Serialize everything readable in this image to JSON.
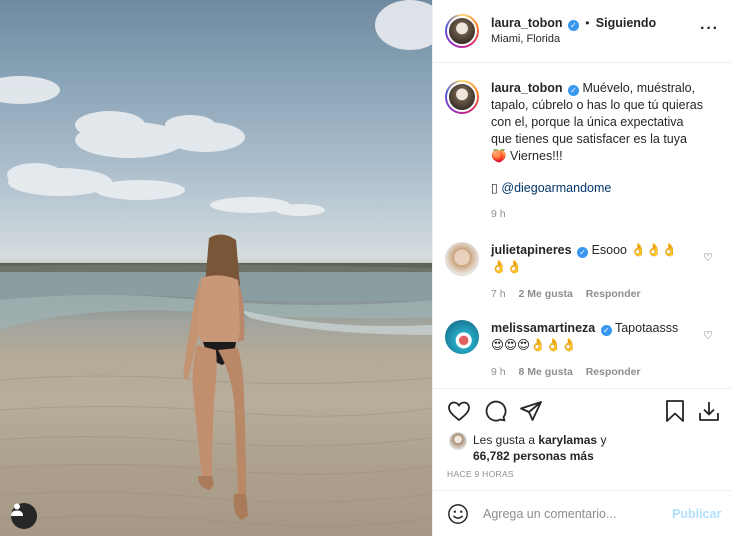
{
  "post": {
    "username": "laura_tobon",
    "follow_separator": "•",
    "follow_status": "Siguiendo",
    "location": "Miami, Florida",
    "more_icon": "more-horizontal-icon",
    "verified_icon": "verified-badge-icon"
  },
  "caption": {
    "username": "laura_tobon",
    "text": "Muévelo, muéstralo, tapalo, cúbrelo o has lo que tú quieras con el, porque la única expectativa que tienes que satisfacer es la tuya 🍑 Viernes!!!",
    "photo_credit_glyph": "▯",
    "photo_credit": "@diegoarmandome",
    "time": "9 h"
  },
  "comments": [
    {
      "username": "julietapineres",
      "text": "Esooo 👌👌👌👌👌",
      "time": "7 h",
      "likes": "2 Me gusta",
      "reply": "Responder"
    },
    {
      "username": "melissamartineza",
      "text": "Tapotaasss 😍😍😍👌👌👌",
      "time": "9 h",
      "likes": "8 Me gusta",
      "reply": "Responder"
    }
  ],
  "actions": {
    "icons": [
      "heart-icon",
      "comment-icon",
      "share-icon",
      "bookmark-icon",
      "download-icon"
    ]
  },
  "likes": {
    "prefix": "Les gusta a",
    "user": "karylamas",
    "joiner": "y",
    "count": "66,782 personas más"
  },
  "posted_ago": "HACE 9 HORAS",
  "comment_box": {
    "placeholder": "Agrega un comentario...",
    "post_label": "Publicar",
    "emoji_icon": "smiley-icon"
  },
  "colors": {
    "verified": "#3897f0",
    "link": "#00376b",
    "muted": "#8e8e8e",
    "post_button_disabled": "#b2dffc"
  }
}
